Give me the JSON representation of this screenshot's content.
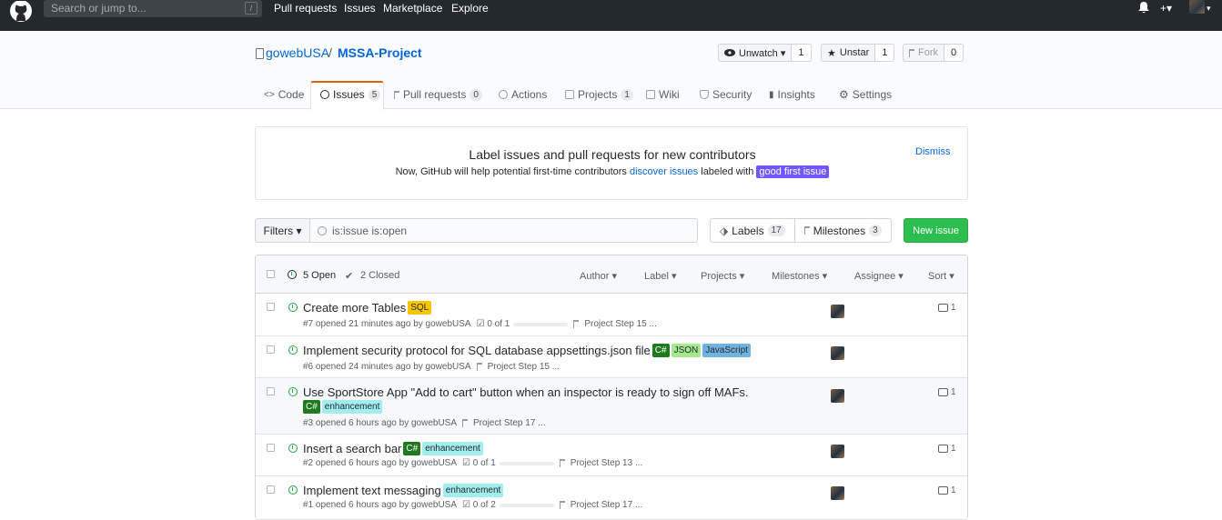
{
  "topnav": {
    "search_placeholder": "Search or jump to...",
    "slash_key": "/",
    "links": [
      "Pull requests",
      "Issues",
      "Marketplace",
      "Explore"
    ],
    "plus": "+▾",
    "avatar_caret": "▾"
  },
  "repo": {
    "owner": "gowebUSA",
    "separator": "/",
    "name": "MSSA-Project",
    "unwatch_label": "Unwatch ▾",
    "unwatch_count": "1",
    "unstar_label": "Unstar",
    "unstar_count": "1",
    "fork_label": "Fork",
    "fork_count": "0"
  },
  "tabs": {
    "code": "Code",
    "issues": "Issues",
    "issues_count": "5",
    "pulls": "Pull requests",
    "pulls_count": "0",
    "actions": "Actions",
    "projects": "Projects",
    "projects_count": "1",
    "wiki": "Wiki",
    "security": "Security",
    "insights": "Insights",
    "settings": "Settings"
  },
  "banner": {
    "title": "Label issues and pull requests for new contributors",
    "text_prefix": "Now, GitHub will help potential first-time contributors",
    "link": "discover issues",
    "text_mid": "labeled with",
    "label": "good first issue",
    "dismiss": "Dismiss"
  },
  "filterbar": {
    "filters_label": "Filters ▾",
    "query": "is:issue is:open",
    "labels_label": "Labels",
    "labels_count": "17",
    "milestones_label": "Milestones",
    "milestones_count": "3",
    "new_issue": "New issue"
  },
  "list_header": {
    "open": "5 Open",
    "closed": "2 Closed",
    "author": "Author ▾",
    "label": "Label ▾",
    "projects": "Projects ▾",
    "milestones": "Milestones ▾",
    "assignee": "Assignee ▾",
    "sort": "Sort ▾"
  },
  "issues": [
    {
      "title": "Create more Tables",
      "labels": [
        {
          "text": "SQL",
          "bg": "#f7c600",
          "fg": "#24292e"
        }
      ],
      "meta": "#7 opened 21 minutes ago by gowebUSA",
      "progress": "0 of 1",
      "project": "Project Step 15 ...",
      "comments": "1"
    },
    {
      "title": "Implement security protocol for SQL database appsettings.json file",
      "labels": [
        {
          "text": "C#",
          "bg": "#1f7a1f",
          "fg": "#ffffff"
        },
        {
          "text": "JSON",
          "bg": "#a4e98d",
          "fg": "#24292e"
        },
        {
          "text": "JavaScript",
          "bg": "#71b3e0",
          "fg": "#24292e"
        }
      ],
      "meta": "#6 opened 24 minutes ago by gowebUSA",
      "progress": "",
      "project": "Project Step 15 ...",
      "comments": ""
    },
    {
      "title": "Use SportStore App \"Add to cart\" button when an inspector is ready to sign off MAFs.",
      "labels": [
        {
          "text": "C#",
          "bg": "#1f7a1f",
          "fg": "#ffffff"
        },
        {
          "text": "enhancement",
          "bg": "#a2eeef",
          "fg": "#24292e"
        }
      ],
      "meta": "#3 opened 6 hours ago by gowebUSA",
      "progress": "",
      "project": "Project Step 17 ...",
      "comments": "1"
    },
    {
      "title": "Insert a search bar",
      "labels": [
        {
          "text": "C#",
          "bg": "#1f7a1f",
          "fg": "#ffffff"
        },
        {
          "text": "enhancement",
          "bg": "#a2eeef",
          "fg": "#24292e"
        }
      ],
      "meta": "#2 opened 6 hours ago by gowebUSA",
      "progress": "0 of 1",
      "project": "Project Step 13 ...",
      "comments": "1"
    },
    {
      "title": "Implement text messaging",
      "labels": [
        {
          "text": "enhancement",
          "bg": "#a2eeef",
          "fg": "#24292e"
        }
      ],
      "meta": "#1 opened 6 hours ago by gowebUSA",
      "progress": "0 of 2",
      "project": "Project Step 17 ...",
      "comments": "1"
    }
  ]
}
